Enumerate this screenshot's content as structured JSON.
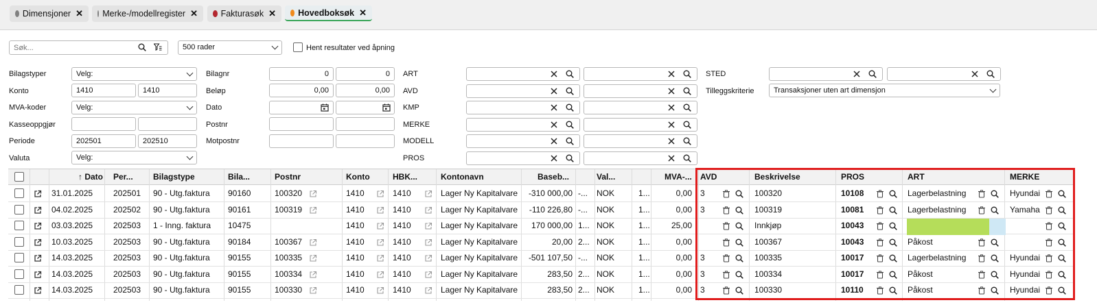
{
  "tabs": [
    {
      "label": "Dimensjoner",
      "color": "#808080",
      "active": false
    },
    {
      "label": "Merke-/modellregister",
      "color": "#808080",
      "active": false
    },
    {
      "label": "Fakturasøk",
      "color": "#b3262e",
      "active": false
    },
    {
      "label": "Hovedboksøk",
      "color": "#f08a1c",
      "active": true
    }
  ],
  "toolbar": {
    "search_placeholder": "Søk...",
    "rows_select": "500 rader",
    "fetch_on_open_label": "Hent resultater ved åpning"
  },
  "filters": {
    "bilagstyper": {
      "label": "Bilagstyper",
      "value": "Velg:"
    },
    "konto": {
      "label": "Konto",
      "from": "1410",
      "to": "1410"
    },
    "mva": {
      "label": "MVA-koder",
      "value": "Velg:"
    },
    "kasse": {
      "label": "Kasseoppgjør",
      "from": "",
      "to": ""
    },
    "periode": {
      "label": "Periode",
      "from": "202501",
      "to": "202510"
    },
    "valuta": {
      "label": "Valuta",
      "value": "Velg:"
    },
    "bilagnr": {
      "label": "Bilagnr",
      "from": "0",
      "to": "0"
    },
    "belop": {
      "label": "Beløp",
      "from": "0,00",
      "to": "0,00"
    },
    "dato": {
      "label": "Dato",
      "from": "",
      "to": ""
    },
    "postnr": {
      "label": "Postnr",
      "from": "",
      "to": ""
    },
    "motpostnr": {
      "label": "Motpostnr",
      "from": "",
      "to": ""
    },
    "art": {
      "label": "ART"
    },
    "avd": {
      "label": "AVD"
    },
    "kmp": {
      "label": "KMP"
    },
    "merke": {
      "label": "MERKE"
    },
    "modell": {
      "label": "MODELL"
    },
    "pros": {
      "label": "PROS"
    },
    "sted": {
      "label": "STED"
    },
    "tillegg": {
      "label": "Tilleggskriterie",
      "value": "Transaksjoner uten art dimensjon"
    }
  },
  "columns": {
    "dato": "↑ Dato",
    "per": "Per...",
    "bilagstype": "Bilagstype",
    "bila": "Bila...",
    "postnr": "Postnr",
    "konto": "Konto",
    "hbk": "HBK...",
    "kontonavn": "Kontonavn",
    "baseb": "Baseb...",
    "val": "Val...",
    "mva": "MVA-...",
    "avd": "AVD",
    "beskrivelse": "Beskrivelse",
    "pros": "PROS",
    "art": "ART",
    "merke": "MERKE"
  },
  "rows": [
    {
      "dato": "31.01.2025",
      "per": "202501",
      "bilagstype": "90 - Utg.faktura",
      "bila": "90160",
      "postnr": "100320",
      "konto": "1410",
      "hbk": "1410",
      "kontonavn": "Lager Ny Kapitalvare",
      "baseb": "-310 000,00",
      "c1": "-...",
      "val": "NOK",
      "c2": "1...",
      "mva": "0,00",
      "avd": "3",
      "beskrivelse": "100320",
      "pros": "10108",
      "art": "Lagerbelastning",
      "merke": "Hyundai"
    },
    {
      "dato": "04.02.2025",
      "per": "202502",
      "bilagstype": "90 - Utg.faktura",
      "bila": "90161",
      "postnr": "100319",
      "konto": "1410",
      "hbk": "1410",
      "kontonavn": "Lager Ny Kapitalvare",
      "baseb": "-110 226,80",
      "c1": "-...",
      "val": "NOK",
      "c2": "1...",
      "mva": "0,00",
      "avd": "3",
      "beskrivelse": "100319",
      "pros": "10081",
      "art": "Lagerbelastning",
      "merke": "Yamaha"
    },
    {
      "dato": "03.03.2025",
      "per": "202503",
      "bilagstype": "1 - Inng. faktura",
      "bila": "10475",
      "postnr": "",
      "konto": "1410",
      "hbk": "1410",
      "kontonavn": "Lager Ny Kapitalvare",
      "baseb": "170 000,00",
      "c1": "1...",
      "val": "NOK",
      "c2": "1...",
      "mva": "25,00",
      "avd": "",
      "beskrivelse": "Innkjøp",
      "pros": "10043",
      "art": "",
      "merke": ""
    },
    {
      "dato": "10.03.2025",
      "per": "202503",
      "bilagstype": "90 - Utg.faktura",
      "bila": "90184",
      "postnr": "100367",
      "konto": "1410",
      "hbk": "1410",
      "kontonavn": "Lager Ny Kapitalvare",
      "baseb": "20,00",
      "c1": "2...",
      "val": "NOK",
      "c2": "1...",
      "mva": "0,00",
      "avd": "",
      "beskrivelse": "100367",
      "pros": "10043",
      "art": "Påkost",
      "merke": ""
    },
    {
      "dato": "14.03.2025",
      "per": "202503",
      "bilagstype": "90 - Utg.faktura",
      "bila": "90155",
      "postnr": "100335",
      "konto": "1410",
      "hbk": "1410",
      "kontonavn": "Lager Ny Kapitalvare",
      "baseb": "-501 107,50",
      "c1": "-...",
      "val": "NOK",
      "c2": "1...",
      "mva": "0,00",
      "avd": "3",
      "beskrivelse": "100335",
      "pros": "10017",
      "art": "Lagerbelastning",
      "merke": "Hyundai"
    },
    {
      "dato": "14.03.2025",
      "per": "202503",
      "bilagstype": "90 - Utg.faktura",
      "bila": "90155",
      "postnr": "100334",
      "konto": "1410",
      "hbk": "1410",
      "kontonavn": "Lager Ny Kapitalvare",
      "baseb": "283,50",
      "c1": "2...",
      "val": "NOK",
      "c2": "1...",
      "mva": "0,00",
      "avd": "3",
      "beskrivelse": "100334",
      "pros": "10017",
      "art": "Påkost",
      "merke": "Hyundai"
    },
    {
      "dato": "14.03.2025",
      "per": "202503",
      "bilagstype": "90 - Utg.faktura",
      "bila": "90155",
      "postnr": "100330",
      "konto": "1410",
      "hbk": "1410",
      "kontonavn": "Lager Ny Kapitalvare",
      "baseb": "283,50",
      "c1": "2...",
      "val": "NOK",
      "c2": "1...",
      "mva": "0,00",
      "avd": "3",
      "beskrivelse": "100330",
      "pros": "10110",
      "art": "Påkost",
      "merke": "Hyundai"
    }
  ]
}
